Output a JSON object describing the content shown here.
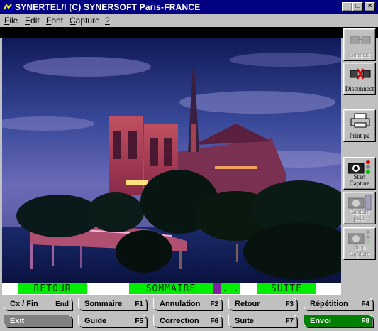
{
  "window": {
    "title": "SYNERTEL/I (C) SYNERSOFT Paris-FRANCE",
    "controls": {
      "minimize": "_",
      "maximize": "□",
      "close": "×"
    }
  },
  "menu": {
    "items": [
      {
        "first": "F",
        "rest": "ile"
      },
      {
        "first": "E",
        "rest": "dit"
      },
      {
        "first": "F",
        "rest": "ont"
      },
      {
        "first": "C",
        "rest": "apture"
      },
      {
        "first": "?",
        "rest": ""
      }
    ]
  },
  "status_line": {
    "left": "RETOUR",
    "center": "SOMMAIRE",
    "right": "SUITE",
    "dots": ". ."
  },
  "side_buttons": [
    {
      "label": "Connect",
      "enabled": false,
      "icon": "phone-plug-icon"
    },
    {
      "label": "Disconnect",
      "enabled": true,
      "icon": "phone-unplug-icon"
    },
    {
      "label": "Print pg",
      "enabled": true,
      "icon": "printer-icon"
    },
    {
      "label": "Start Capture",
      "line1": "Start",
      "line2": "Capture",
      "enabled": true,
      "icon": "camera-traffic-light-icon"
    },
    {
      "label": "Capture page",
      "line1": "Capture",
      "line2": "page",
      "enabled": false,
      "icon": "camera-icon"
    },
    {
      "label": "Stop Capture",
      "line1": "Stop",
      "line2": "Capture",
      "enabled": false,
      "icon": "camera-stop-icon"
    }
  ],
  "function_keys": [
    {
      "label": "Cx / Fin",
      "key": "End"
    },
    {
      "label": "Sommaire",
      "key": "F1"
    },
    {
      "label": "Annulation",
      "key": "F2"
    },
    {
      "label": "Retour",
      "key": "F3"
    },
    {
      "label": "Répétition",
      "key": "F4"
    },
    {
      "label": "Exit",
      "key": ""
    },
    {
      "label": "Guide",
      "key": "F5"
    },
    {
      "label": "Correction",
      "key": "F6"
    },
    {
      "label": "Suite",
      "key": "F7"
    },
    {
      "label": "Envoi",
      "key": "F8"
    }
  ],
  "colors": {
    "title_bar": "#000080",
    "status_green": "#00ee00",
    "exit_button": "#808080",
    "envoi_button": "#008000"
  }
}
